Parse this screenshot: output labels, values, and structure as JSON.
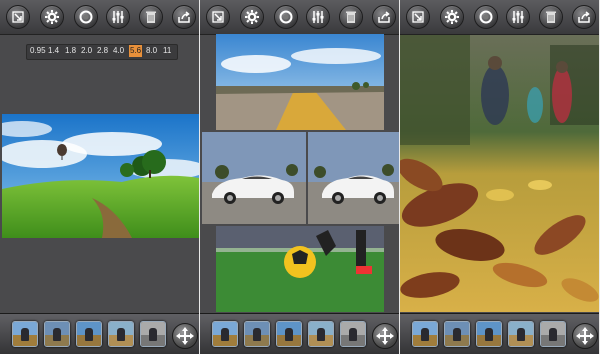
{
  "toolbar_icons": [
    "import-icon",
    "settings-gear-icon",
    "focus-circle-icon",
    "adjust-sliders-icon",
    "trash-icon",
    "share-icon"
  ],
  "fstop_selector": {
    "stops": [
      "0.95",
      "1.4",
      "1.8",
      "2.0",
      "2.8",
      "4.0",
      "5.6",
      "8.0",
      "11"
    ],
    "selected_index": 6
  },
  "accent_color": "#e8903a",
  "filter_thumbnails": 5
}
